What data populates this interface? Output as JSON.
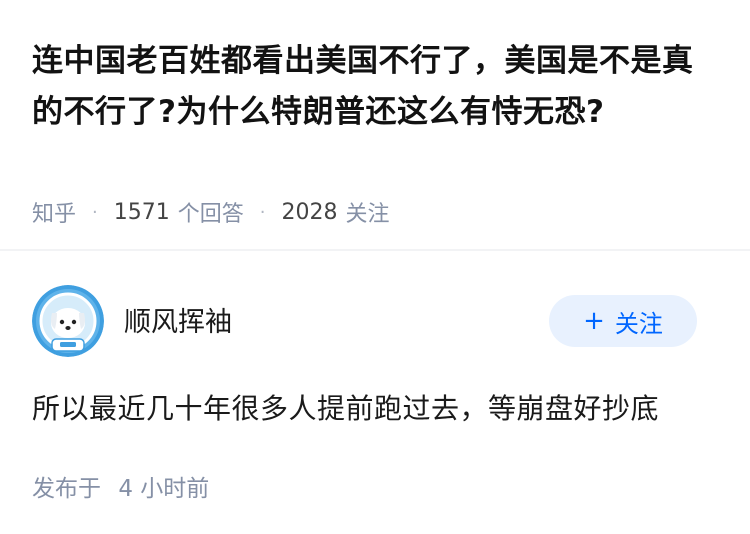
{
  "question": {
    "title": "连中国老百姓都看出美国不行了，美国是不是真的不行了?为什么特朗普还这么有恃无恐?",
    "source": "知乎",
    "separator": "·",
    "answer_count": "1571",
    "answer_label": "个回答",
    "follower_count": "2028",
    "follower_label": "关注"
  },
  "answer": {
    "author": {
      "name": "顺风挥袖",
      "avatar_icon": "dog-astronaut-avatar-icon"
    },
    "follow_button": {
      "icon": "plus-icon",
      "plus": "+",
      "label": "关注"
    },
    "content": "所以最近几十年很多人提前跑过去，等崩盘好抄底",
    "published_label": "发布于",
    "published_time": "4 小时前"
  },
  "colors": {
    "meta_gray": "#8590a6",
    "brand_blue": "#0066ff",
    "button_bg": "#e8f1fe",
    "avatar_bg": "#3f9fe0"
  }
}
